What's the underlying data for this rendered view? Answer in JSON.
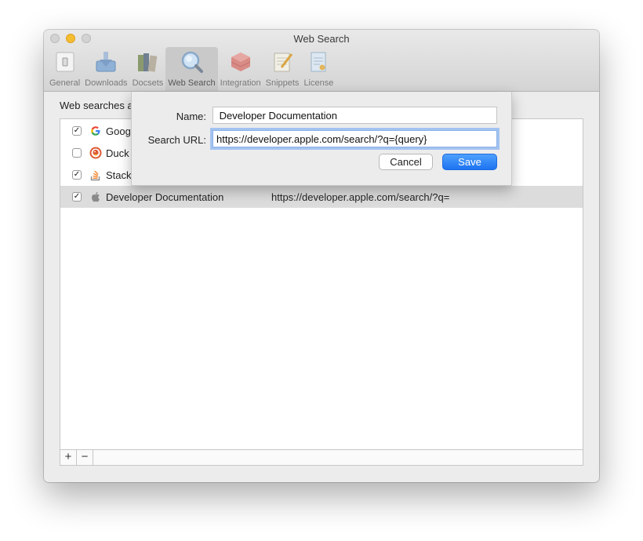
{
  "window": {
    "title": "Web Search"
  },
  "toolbar": {
    "items": [
      {
        "label": "General",
        "icon": "switch-icon"
      },
      {
        "label": "Downloads",
        "icon": "download-icon"
      },
      {
        "label": "Docsets",
        "icon": "books-icon"
      },
      {
        "label": "Web Search",
        "icon": "magnifier-icon",
        "selected": true
      },
      {
        "label": "Integration",
        "icon": "brick-icon"
      },
      {
        "label": "Snippets",
        "icon": "notepad-icon"
      },
      {
        "label": "License",
        "icon": "certificate-icon"
      }
    ]
  },
  "main": {
    "label": "Web searches a",
    "rows": [
      {
        "checked": true,
        "icon": "google-icon",
        "name": "Goog",
        "url": ""
      },
      {
        "checked": false,
        "icon": "duckduckgo-icon",
        "name": "Duck",
        "url": ""
      },
      {
        "checked": true,
        "icon": "stackoverflow-icon",
        "name": "Stack",
        "url": ""
      },
      {
        "checked": true,
        "icon": "apple-icon",
        "name": " Developer Documentation",
        "url": "https://developer.apple.com/search/?q=",
        "selected": true
      }
    ],
    "add_label": "+",
    "remove_label": "−"
  },
  "sheet": {
    "name_label": "Name:",
    "name_value": " Developer Documentation",
    "url_label": "Search URL:",
    "url_value": "https://developer.apple.com/search/?q={query}",
    "cancel_label": "Cancel",
    "save_label": "Save"
  },
  "colors": {
    "accent": "#1d73f1",
    "focus_ring": "#a3c3f0",
    "selection": "#dcdcdc"
  }
}
